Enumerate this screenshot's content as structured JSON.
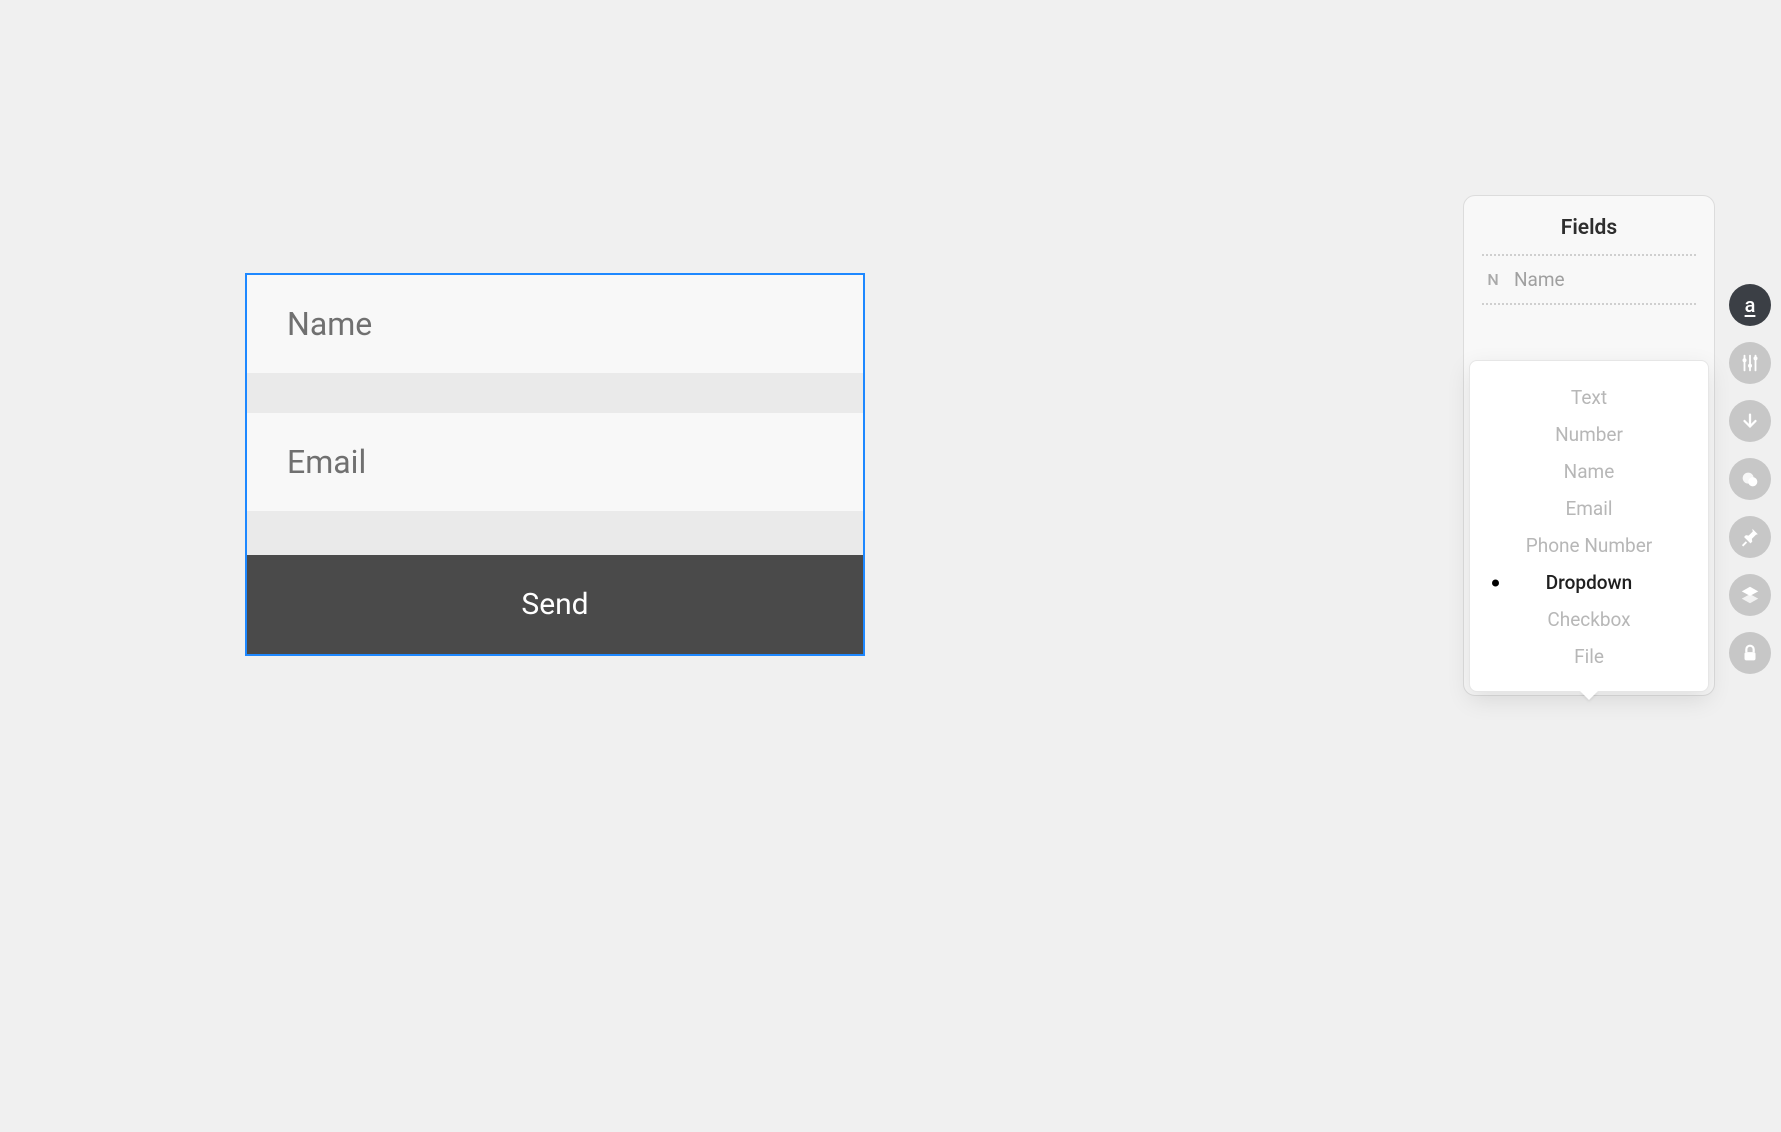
{
  "form": {
    "fields": [
      {
        "label": "Name"
      },
      {
        "label": "Email"
      }
    ],
    "submit_label": "Send"
  },
  "panel": {
    "title": "Fields",
    "entry": {
      "badge": "N",
      "label": "Name"
    },
    "add_glyph": "+"
  },
  "field_types": {
    "options": [
      "Text",
      "Number",
      "Name",
      "Email",
      "Phone Number",
      "Dropdown",
      "Checkbox",
      "File"
    ],
    "selected": "Dropdown"
  },
  "rail": {
    "buttons": [
      {
        "name": "text-tool",
        "icon": "text",
        "active": true
      },
      {
        "name": "settings-tool",
        "icon": "sliders",
        "active": false
      },
      {
        "name": "download-tool",
        "icon": "arrow-down",
        "active": false
      },
      {
        "name": "color-tool",
        "icon": "overlap-circles",
        "active": false
      },
      {
        "name": "pin-tool",
        "icon": "pin",
        "active": false
      },
      {
        "name": "layers-tool",
        "icon": "layers",
        "active": false
      },
      {
        "name": "lock-tool",
        "icon": "lock",
        "active": false
      }
    ]
  }
}
